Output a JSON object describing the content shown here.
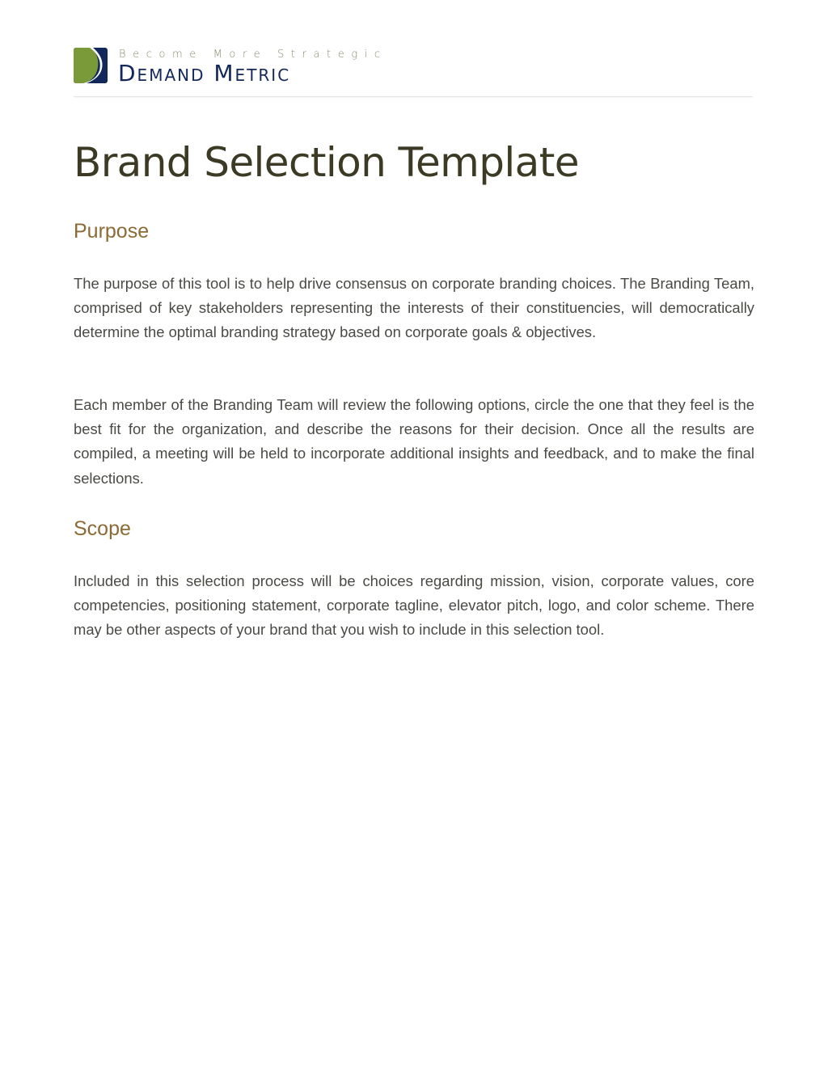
{
  "header": {
    "logo": {
      "icon": "demand-metric-logo-icon",
      "tagline": "Become More Strategic",
      "brand_name": "Demand Metric",
      "colors": {
        "green": "#7a9a3a",
        "navy": "#13285a"
      }
    }
  },
  "document": {
    "title": "Brand Selection Template",
    "sections": [
      {
        "heading": "Purpose",
        "paragraphs": [
          "The purpose of this tool is to help drive consensus on corporate branding choices. The Branding Team, comprised of key stakeholders representing the interests of their constituencies, will democratically determine the optimal branding strategy based on corporate goals & objectives.",
          "Each member of the Branding Team will review the following options, circle the one that they feel is the best fit for the organization, and describe the reasons for their decision.  Once all the results are compiled, a meeting will be held to incorporate additional insights and feedback, and to make the final selections."
        ]
      },
      {
        "heading": "Scope",
        "paragraphs": [
          "Included in this selection process will be choices regarding mission, vision, corporate values, core competencies, positioning statement, corporate tagline, elevator pitch, logo, and color scheme.  There may be other aspects of your brand that you wish to include in this selection tool."
        ]
      }
    ]
  },
  "colors": {
    "title": "#3c3a24",
    "heading": "#8b6a35",
    "body_text": "#4a4a45",
    "rule": "#e4e4e4"
  }
}
